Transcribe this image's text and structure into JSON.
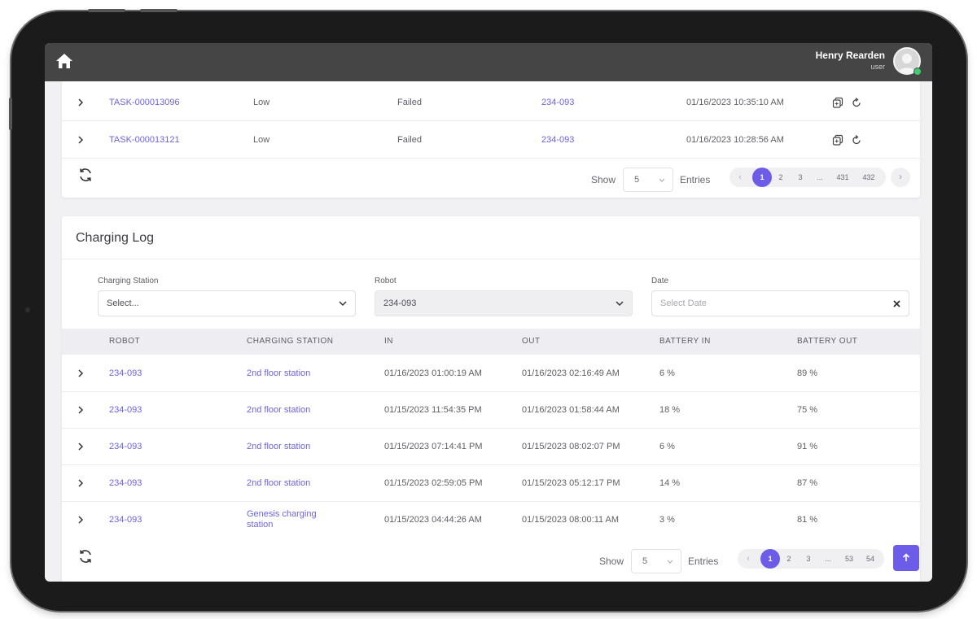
{
  "header": {
    "user_name": "Henry Rearden",
    "user_role": "user"
  },
  "tasks": {
    "rows": [
      {
        "task": "TASK-000013096",
        "priority": "Low",
        "status": "Failed",
        "robot": "234-093",
        "time": "01/16/2023 10:35:10 AM"
      },
      {
        "task": "TASK-000013121",
        "priority": "Low",
        "status": "Failed",
        "robot": "234-093",
        "time": "01/16/2023 10:28:56 AM"
      }
    ],
    "pager": {
      "show_label": "Show",
      "entries_value": "5",
      "entries_label": "Entries",
      "pages": [
        "1",
        "2",
        "3",
        "...",
        "431",
        "432"
      ],
      "active_page": "1"
    }
  },
  "charging_log": {
    "title": "Charging Log",
    "filters": {
      "station_label": "Charging Station",
      "station_value": "Select...",
      "robot_label": "Robot",
      "robot_value": "234-093",
      "date_label": "Date",
      "date_placeholder": "Select Date"
    },
    "columns": [
      "ROBOT",
      "CHARGING STATION",
      "IN",
      "OUT",
      "BATTERY IN",
      "BATTERY OUT"
    ],
    "rows": [
      {
        "robot": "234-093",
        "station": "2nd floor station",
        "station2": "",
        "in": "01/16/2023 01:00:19 AM",
        "out": "01/16/2023 02:16:49 AM",
        "battery_in": "6 %",
        "battery_out": "89 %"
      },
      {
        "robot": "234-093",
        "station": "2nd floor station",
        "station2": "",
        "in": "01/15/2023 11:54:35 PM",
        "out": "01/16/2023 01:58:44 AM",
        "battery_in": "18 %",
        "battery_out": "75 %"
      },
      {
        "robot": "234-093",
        "station": "2nd floor station",
        "station2": "",
        "in": "01/15/2023 07:14:41 PM",
        "out": "01/15/2023 08:02:07 PM",
        "battery_in": "6 %",
        "battery_out": "91 %"
      },
      {
        "robot": "234-093",
        "station": "2nd floor station",
        "station2": "",
        "in": "01/15/2023 02:59:05 PM",
        "out": "01/15/2023 05:12:17 PM",
        "battery_in": "14 %",
        "battery_out": "87 %"
      },
      {
        "robot": "234-093",
        "station": "Genesis charging",
        "station2": "station",
        "in": "01/15/2023 04:44:26 AM",
        "out": "01/15/2023 08:00:11 AM",
        "battery_in": "3 %",
        "battery_out": "81 %"
      }
    ],
    "pager": {
      "show_label": "Show",
      "entries_value": "5",
      "entries_label": "Entries",
      "pages": [
        "1",
        "2",
        "3",
        "...",
        "53",
        "54"
      ],
      "active_page": "1"
    }
  },
  "icons": {
    "home": "home-icon",
    "expand": "chevron-right-icon",
    "copy": "copy-icon",
    "retry": "retry-icon",
    "refresh": "refresh-icon",
    "dropdown": "chevron-down-icon",
    "clear": "close-icon",
    "scroll_top": "arrow-up-icon"
  },
  "colors": {
    "accent": "#6c5ce7",
    "link": "#6c63e0",
    "topbar": "#454545",
    "online": "#3ccb6d"
  }
}
